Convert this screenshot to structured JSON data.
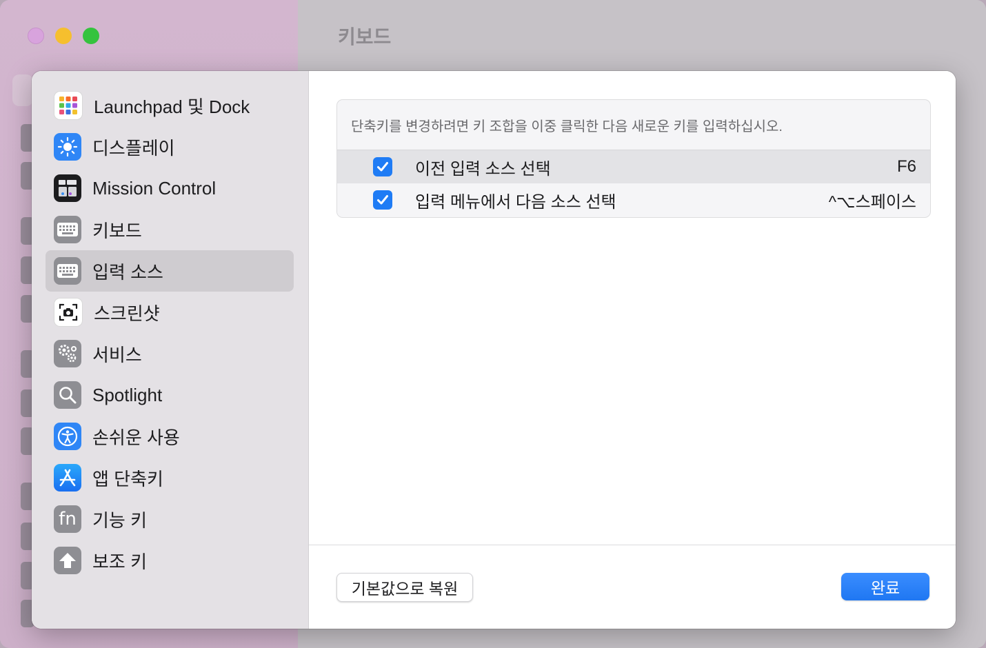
{
  "background_window": {
    "title": "키보드"
  },
  "sidebar": {
    "items": [
      {
        "label": "Launchpad 및 Dock",
        "icon": "launchpad-icon"
      },
      {
        "label": "디스플레이",
        "icon": "display-icon"
      },
      {
        "label": "Mission Control",
        "icon": "mission-control-icon"
      },
      {
        "label": "키보드",
        "icon": "keyboard-icon"
      },
      {
        "label": "입력 소스",
        "icon": "input-sources-icon",
        "selected": true
      },
      {
        "label": "스크린샷",
        "icon": "screenshot-icon"
      },
      {
        "label": "서비스",
        "icon": "gears-icon"
      },
      {
        "label": "Spotlight",
        "icon": "spotlight-icon"
      },
      {
        "label": "손쉬운 사용",
        "icon": "accessibility-icon"
      },
      {
        "label": "앱 단축키",
        "icon": "app-store-icon"
      },
      {
        "label": "기능 키",
        "icon": "fn-key-icon"
      },
      {
        "label": "보조 키",
        "icon": "modifier-key-icon"
      }
    ]
  },
  "main": {
    "hint": "단축키를 변경하려면 키 조합을 이중 클릭한 다음 새로운 키를 입력하십시오.",
    "shortcuts": [
      {
        "label": "이전 입력 소스 선택",
        "key": "F6",
        "checked": true
      },
      {
        "label": "입력 메뉴에서 다음 소스 선택",
        "key": "^⌥스페이스",
        "checked": true
      }
    ],
    "fn_glyph": "fn"
  },
  "footer": {
    "reset_label": "기본값으로 복원",
    "done_label": "완료"
  },
  "colors": {
    "accent": "#1f7cf5",
    "selected_row": "#cfccd0"
  }
}
